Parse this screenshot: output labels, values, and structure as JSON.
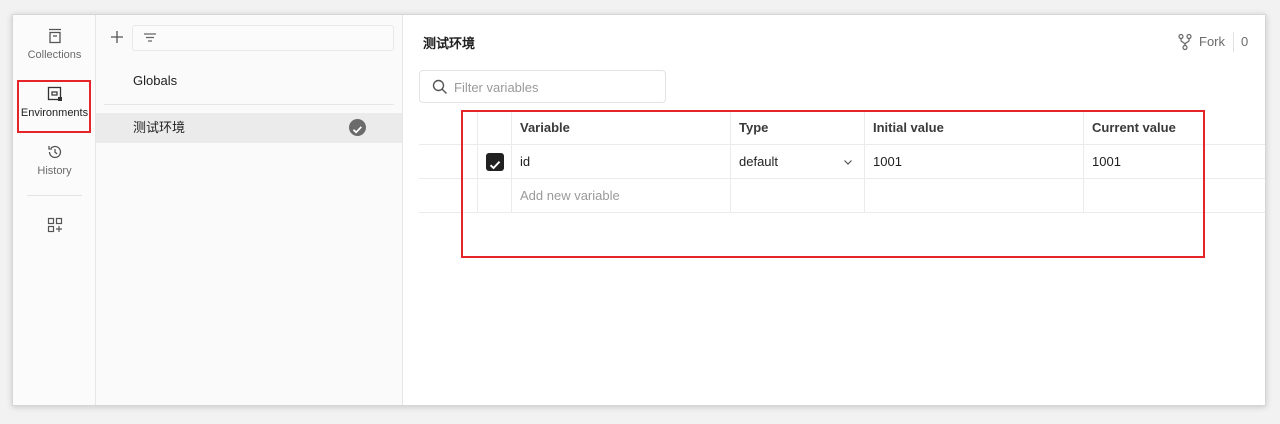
{
  "rail": {
    "collections_label": "Collections",
    "environments_label": "Environments",
    "history_label": "History",
    "icons": [
      "collections-icon",
      "environments-icon",
      "history-icon",
      "configure-workbench-icon"
    ]
  },
  "env_list": {
    "items": [
      {
        "label": "Globals"
      },
      {
        "label": "测试环境",
        "active": true
      }
    ]
  },
  "editor": {
    "title": "测试环境",
    "fork_label": "Fork",
    "fork_count": "0",
    "search_placeholder": "Filter variables",
    "columns": [
      "Variable",
      "Type",
      "Initial value",
      "Current value"
    ],
    "rows": [
      {
        "checked": true,
        "variable": "id",
        "type": "default",
        "initial_value": "1001",
        "current_value": "1001"
      }
    ],
    "new_variable_placeholder": "Add new variable"
  },
  "colors": {
    "highlight": "#e5252a",
    "active_row_bg": "#ebebeb",
    "checkbox": "#212121"
  }
}
